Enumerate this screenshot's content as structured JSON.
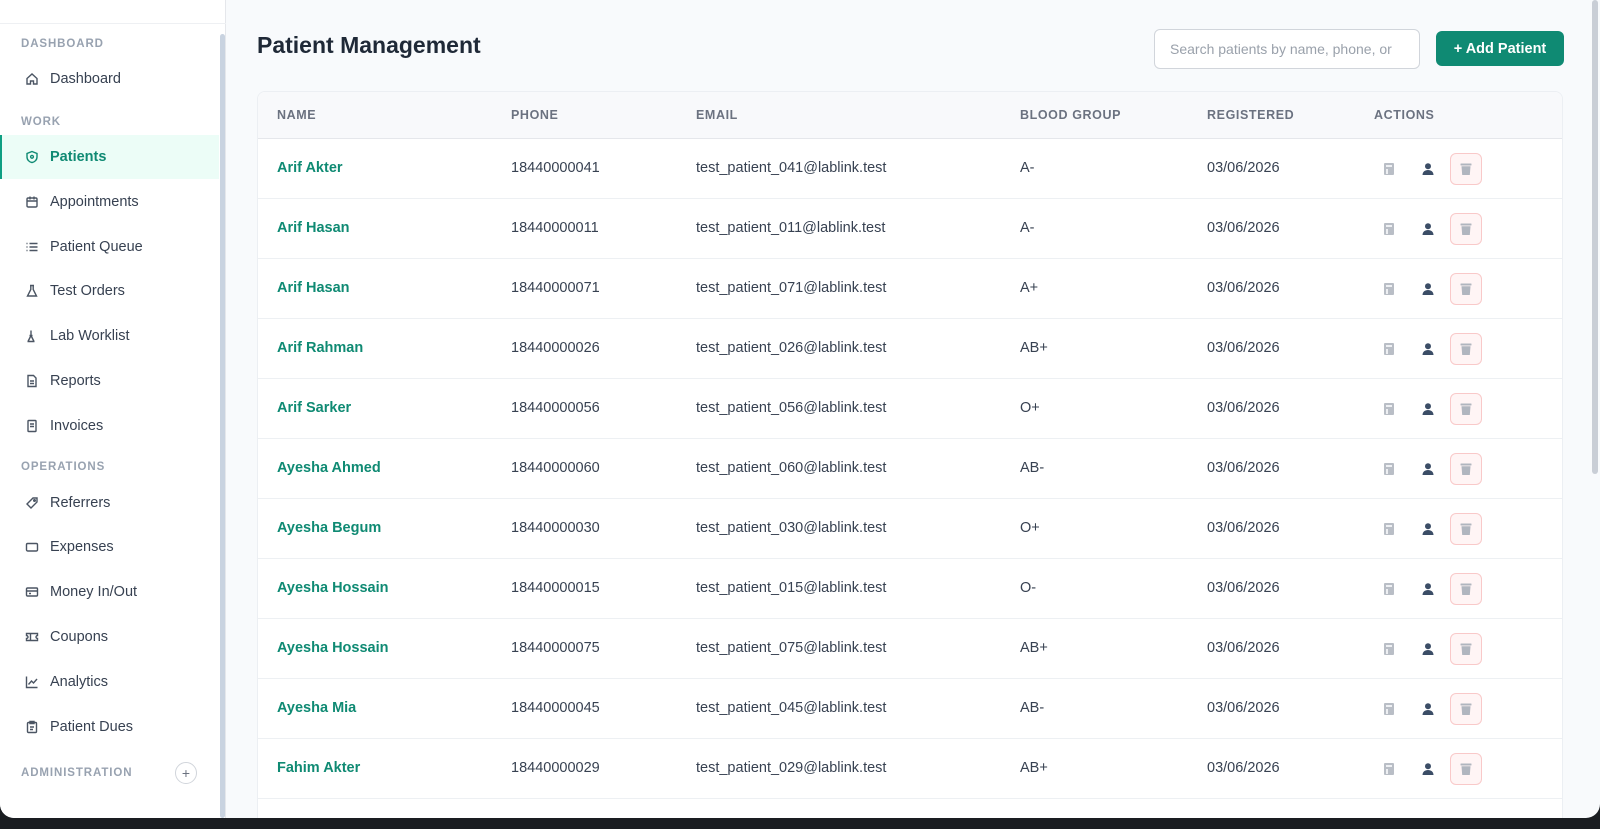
{
  "sidebar": {
    "sections": {
      "dashboard": "DASHBOARD",
      "work": "WORK",
      "operations": "OPERATIONS",
      "administration": "ADMINISTRATION"
    },
    "items": [
      {
        "label": "Dashboard",
        "icon": "home-icon"
      },
      {
        "label": "Patients",
        "icon": "shield-heart-icon",
        "active": true
      },
      {
        "label": "Appointments",
        "icon": "calendar-icon"
      },
      {
        "label": "Patient Queue",
        "icon": "list-icon"
      },
      {
        "label": "Test Orders",
        "icon": "flask-icon"
      },
      {
        "label": "Lab Worklist",
        "icon": "microscope-icon"
      },
      {
        "label": "Reports",
        "icon": "document-icon"
      },
      {
        "label": "Invoices",
        "icon": "receipt-icon"
      },
      {
        "label": "Referrers",
        "icon": "tag-icon"
      },
      {
        "label": "Expenses",
        "icon": "wallet-icon"
      },
      {
        "label": "Money In/Out",
        "icon": "cash-icon"
      },
      {
        "label": "Coupons",
        "icon": "ticket-icon"
      },
      {
        "label": "Analytics",
        "icon": "chart-line-icon"
      },
      {
        "label": "Patient Dues",
        "icon": "clipboard-icon"
      }
    ],
    "admin_expand": "+"
  },
  "header": {
    "title": "Patient Management",
    "search_placeholder": "Search patients by name, phone, or",
    "add_button": "+ Add Patient"
  },
  "table": {
    "columns": [
      "NAME",
      "PHONE",
      "EMAIL",
      "BLOOD GROUP",
      "REGISTERED",
      "ACTIONS"
    ],
    "rows": [
      {
        "name": "Arif Akter",
        "phone": "18440000041",
        "email": "test_patient_041@lablink.test",
        "blood": "A-",
        "registered": "03/06/2026"
      },
      {
        "name": "Arif Hasan",
        "phone": "18440000011",
        "email": "test_patient_011@lablink.test",
        "blood": "A-",
        "registered": "03/06/2026"
      },
      {
        "name": "Arif Hasan",
        "phone": "18440000071",
        "email": "test_patient_071@lablink.test",
        "blood": "A+",
        "registered": "03/06/2026"
      },
      {
        "name": "Arif Rahman",
        "phone": "18440000026",
        "email": "test_patient_026@lablink.test",
        "blood": "AB+",
        "registered": "03/06/2026"
      },
      {
        "name": "Arif Sarker",
        "phone": "18440000056",
        "email": "test_patient_056@lablink.test",
        "blood": "O+",
        "registered": "03/06/2026"
      },
      {
        "name": "Ayesha Ahmed",
        "phone": "18440000060",
        "email": "test_patient_060@lablink.test",
        "blood": "AB-",
        "registered": "03/06/2026"
      },
      {
        "name": "Ayesha Begum",
        "phone": "18440000030",
        "email": "test_patient_030@lablink.test",
        "blood": "O+",
        "registered": "03/06/2026"
      },
      {
        "name": "Ayesha Hossain",
        "phone": "18440000015",
        "email": "test_patient_015@lablink.test",
        "blood": "O-",
        "registered": "03/06/2026"
      },
      {
        "name": "Ayesha Hossain",
        "phone": "18440000075",
        "email": "test_patient_075@lablink.test",
        "blood": "AB+",
        "registered": "03/06/2026"
      },
      {
        "name": "Ayesha Mia",
        "phone": "18440000045",
        "email": "test_patient_045@lablink.test",
        "blood": "AB-",
        "registered": "03/06/2026"
      },
      {
        "name": "Fahim Akter",
        "phone": "18440000029",
        "email": "test_patient_029@lablink.test",
        "blood": "AB+",
        "registered": "03/06/2026"
      }
    ],
    "row_actions": [
      "view-icon",
      "profile-icon",
      "trash-icon"
    ]
  },
  "colors": {
    "accent": "#0f8a73",
    "delete_border": "#f9c9c9"
  }
}
